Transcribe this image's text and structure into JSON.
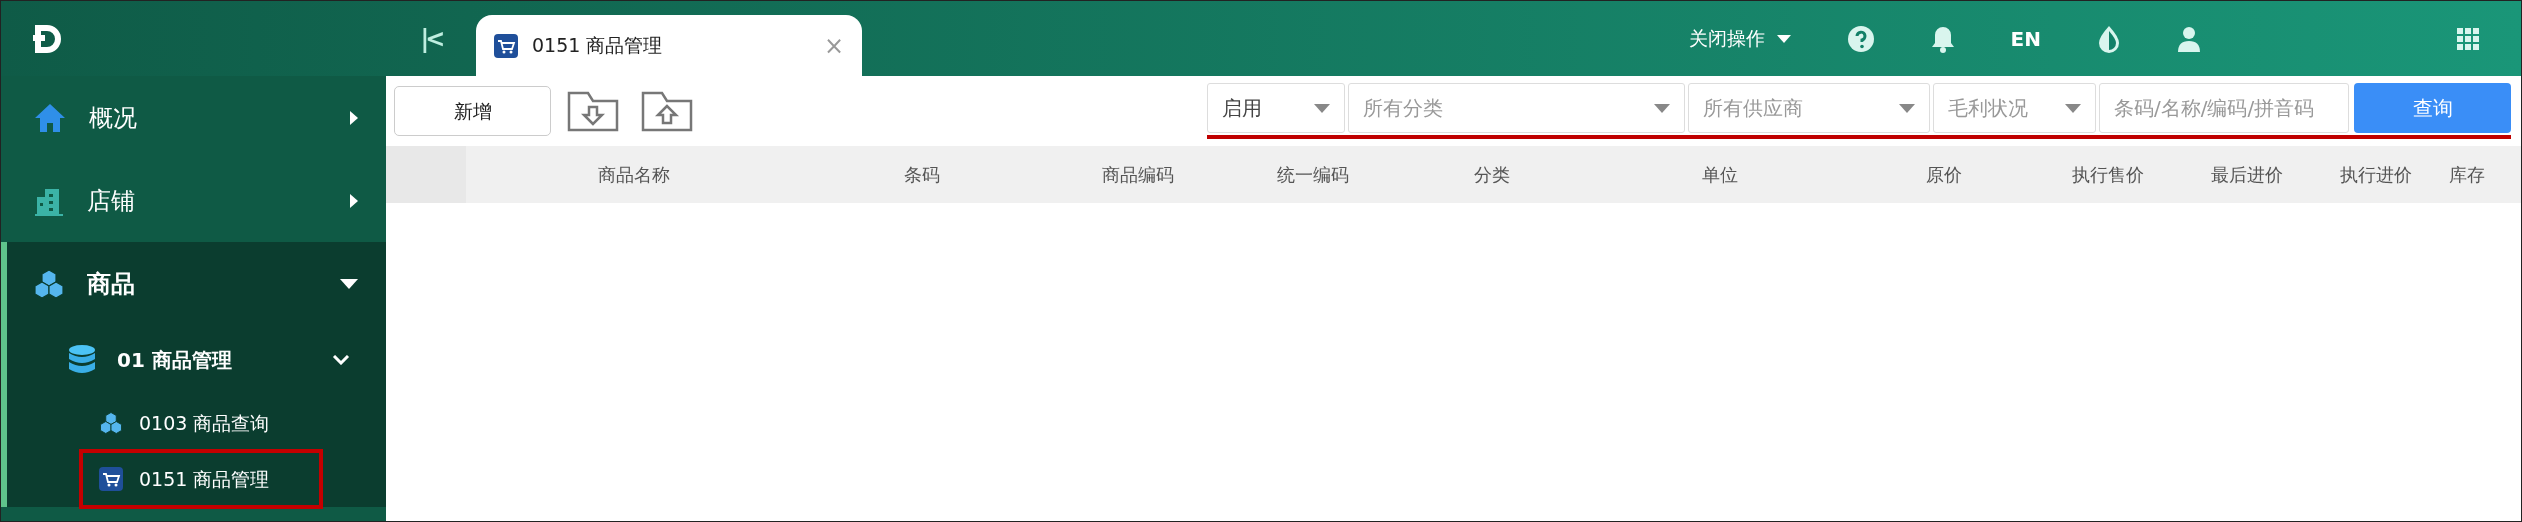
{
  "header": {
    "collapse_glyph": "|<",
    "tabs": [
      {
        "label": "0151 商品管理",
        "selected": true,
        "close_glyph": "×"
      }
    ],
    "actions_menu": "关闭操作",
    "language": "EN"
  },
  "sidebar": {
    "items": [
      {
        "label": "概况",
        "kind": "home",
        "expanded": false
      },
      {
        "label": "店铺",
        "kind": "building",
        "expanded": false
      },
      {
        "label": "商品",
        "kind": "cubes",
        "expanded": true,
        "children": [
          {
            "label": "01 商品管理",
            "kind": "database",
            "expanded": true,
            "children": [
              {
                "label": "0103 商品查询",
                "kind": "cubes",
                "selected": false,
                "highlighted": false
              },
              {
                "label": "0151 商品管理",
                "kind": "cart",
                "selected": false,
                "highlighted": true
              }
            ]
          }
        ]
      }
    ]
  },
  "toolbar": {
    "add_button": "新增",
    "filters": [
      {
        "kind": "select",
        "value": "启用",
        "placeholder": false
      },
      {
        "kind": "select",
        "value": "所有分类",
        "placeholder": true
      },
      {
        "kind": "select",
        "value": "所有供应商",
        "placeholder": true
      },
      {
        "kind": "select",
        "value": "毛利状况",
        "placeholder": true
      },
      {
        "kind": "input",
        "placeholder": "条码/名称/编码/拼音码"
      }
    ],
    "search_button": "查询",
    "filters_underlined": true
  },
  "table": {
    "columns": [
      "商品名称",
      "条码",
      "商品编码",
      "统一编码",
      "分类",
      "单位",
      "原价",
      "执行售价",
      "最后进价",
      "执行进价",
      "库存"
    ]
  }
}
